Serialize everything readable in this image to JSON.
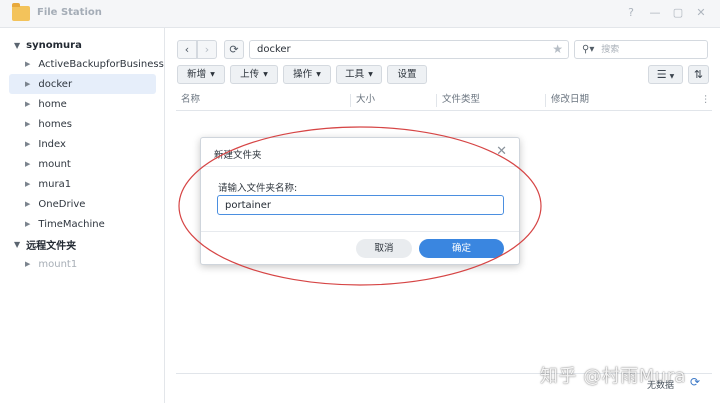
{
  "window": {
    "title": "File Station",
    "icon": "folder-icon",
    "buttons": [
      "?",
      "—",
      "▢",
      "✕"
    ]
  },
  "sidebar": {
    "roots": [
      {
        "label": "synomura",
        "expanded": true
      },
      {
        "label": "远程文件夹",
        "expanded": true
      }
    ],
    "items": [
      {
        "label": "ActiveBackupforBusiness"
      },
      {
        "label": "docker",
        "selected": true
      },
      {
        "label": "home"
      },
      {
        "label": "homes"
      },
      {
        "label": "Index"
      },
      {
        "label": "mount"
      },
      {
        "label": "mura1"
      },
      {
        "label": "OneDrive"
      },
      {
        "label": "TimeMachine"
      }
    ],
    "remote_items": [
      {
        "label": "mount1",
        "disabled": true
      }
    ]
  },
  "toolbar": {
    "back": "‹",
    "forward": "›",
    "refresh": "⟳",
    "path": "docker",
    "search_placeholder": "搜索",
    "buttons": [
      "新增",
      "上传",
      "操作",
      "工具",
      "设置"
    ]
  },
  "table": {
    "columns": [
      "名称",
      "大小",
      "文件类型",
      "修改日期"
    ]
  },
  "footer": {
    "status": "无数据"
  },
  "dialog": {
    "title": "新建文件夹",
    "label": "请输入文件夹名称:",
    "input_value": "portainer",
    "cancel": "取消",
    "ok": "确定"
  },
  "watermark": "知乎 @村雨Mura",
  "colors": {
    "accent": "#3a86e0",
    "selected_bg": "#e6eefa",
    "annotation": "#d64545"
  }
}
